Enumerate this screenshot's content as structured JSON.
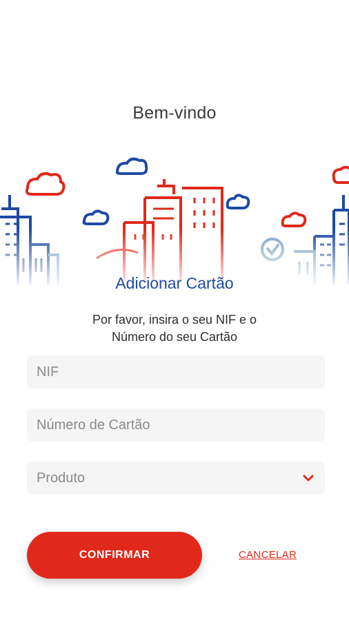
{
  "header": {
    "welcome": "Bem-vindo"
  },
  "card_form": {
    "title": "Adicionar Cartão",
    "instructions_line1": "Por favor, insira o seu NIF e o",
    "instructions_line2": "Número do seu Cartão",
    "nif_placeholder": "NIF",
    "card_number_placeholder": "Número de Cartão",
    "product_placeholder": "Produto",
    "product_icon": "chevron-down-icon"
  },
  "actions": {
    "confirm_label": "CONFIRMAR",
    "cancel_label": "CANCELAR"
  },
  "colors": {
    "brand_red": "#e0291b",
    "brand_blue": "#1d4aa3",
    "field_bg": "#f5f5f5"
  }
}
